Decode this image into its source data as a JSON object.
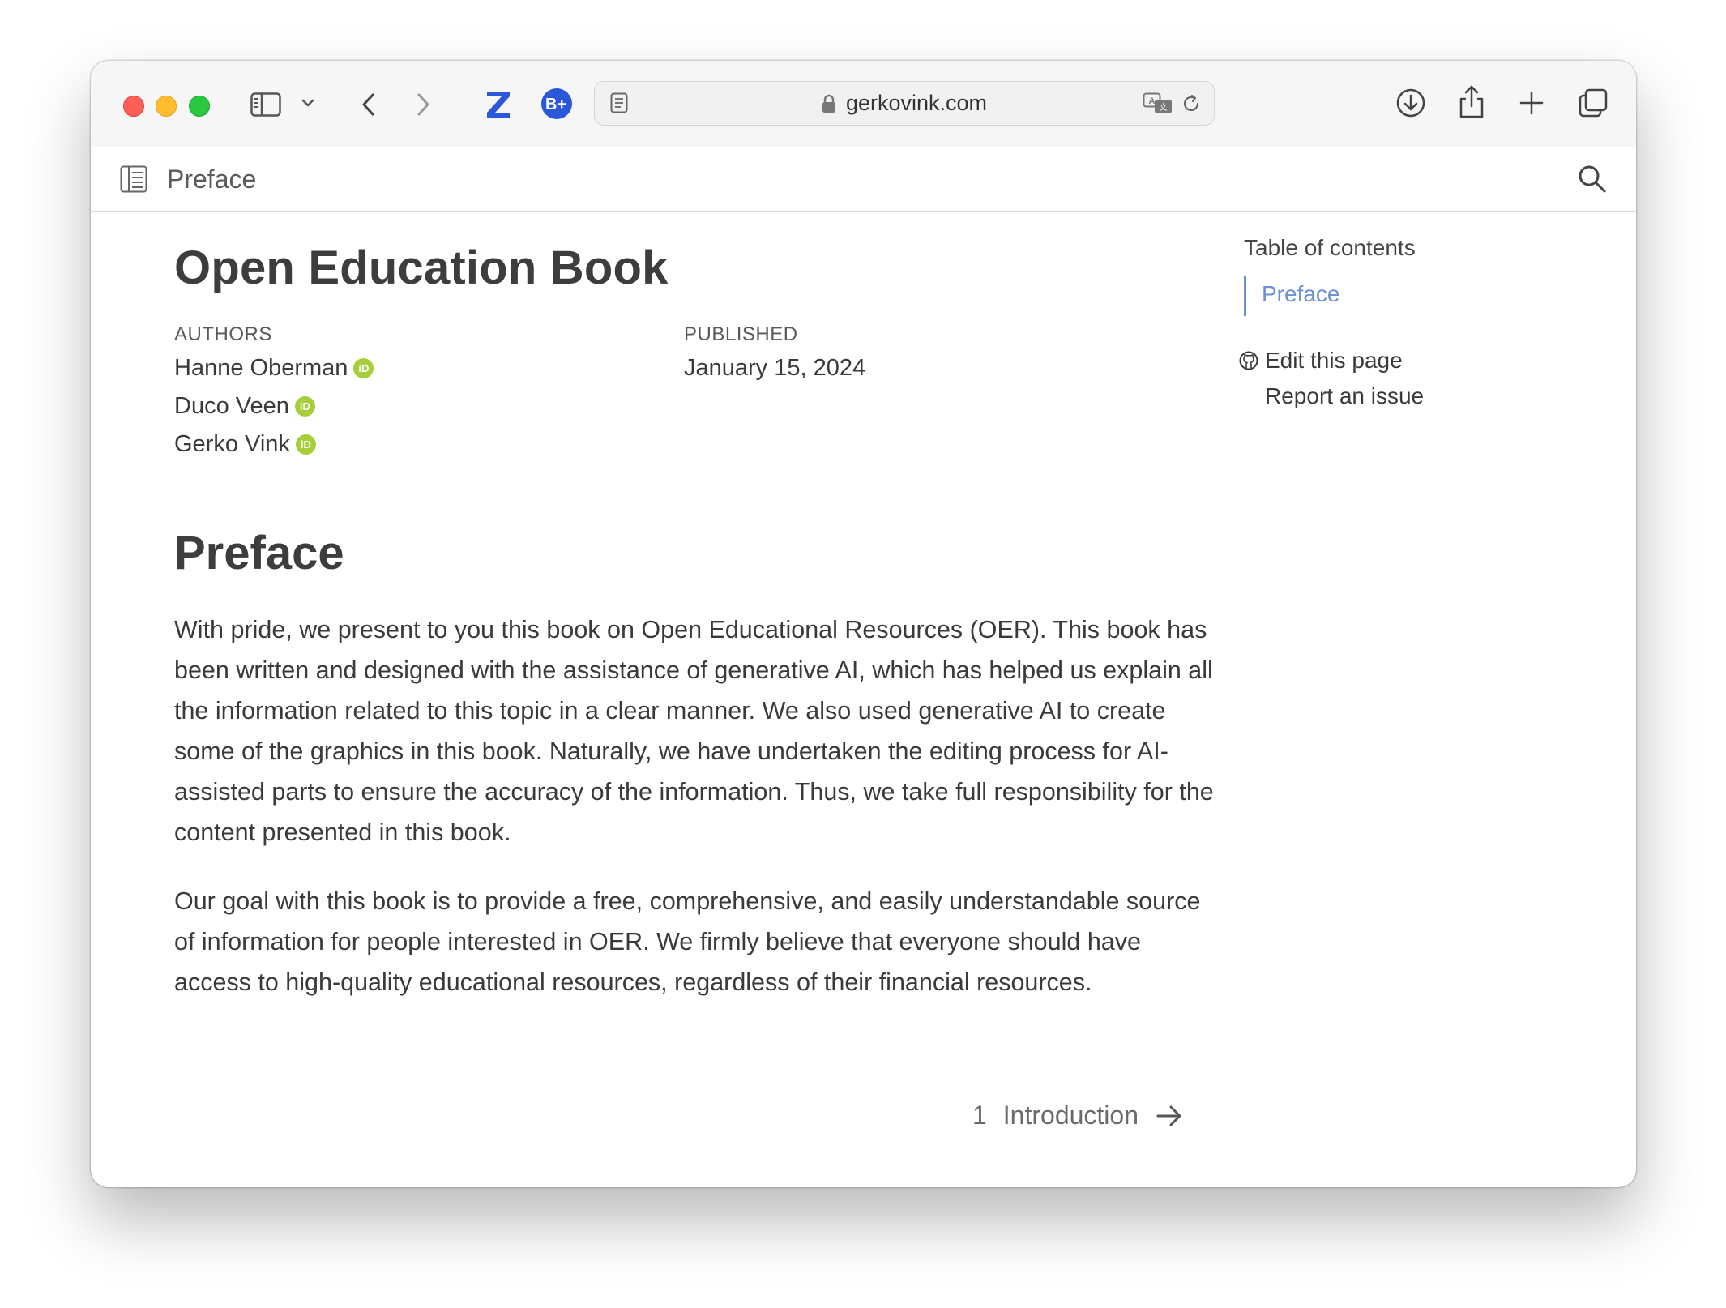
{
  "browser": {
    "url": "gerkovink.com",
    "accent_blue": "#2b57d9"
  },
  "site": {
    "header_title": "Preface"
  },
  "page": {
    "title": "Open Education Book",
    "authors_label": "AUTHORS",
    "published_label": "PUBLISHED",
    "authors": [
      "Hanne Oberman",
      "Duco Veen",
      "Gerko Vink"
    ],
    "orcid_glyph": "iD",
    "published_date": "January 15, 2024",
    "section_title": "Preface",
    "paragraphs": [
      "With pride, we present to you this book on Open Educational Resources (OER). This book has been written and designed with the assistance of generative AI, which has helped us explain all the information related to this topic in a clear manner. We also used generative AI to create some of the graphics in this book. Naturally, we have undertaken the editing process for AI-assisted parts to ensure the accuracy of the information. Thus, we take full responsibility for the content presented in this book.",
      "Our goal with this book is to provide a free, comprehensive, and easily understandable source of information for people interested in OER. We firmly believe that everyone should have access to high-quality educational resources, regardless of their financial resources."
    ],
    "next": {
      "number": "1",
      "label": "Introduction"
    }
  },
  "toc": {
    "title": "Table of contents",
    "items": [
      "Preface"
    ],
    "active_color": "#6b90d6",
    "edit_label": "Edit this page",
    "issue_label": "Report an issue"
  },
  "colors": {
    "orcid_green": "#a6ce39",
    "traffic_red": "#ff5f57",
    "traffic_yellow": "#febc2e",
    "traffic_green": "#28c840"
  }
}
